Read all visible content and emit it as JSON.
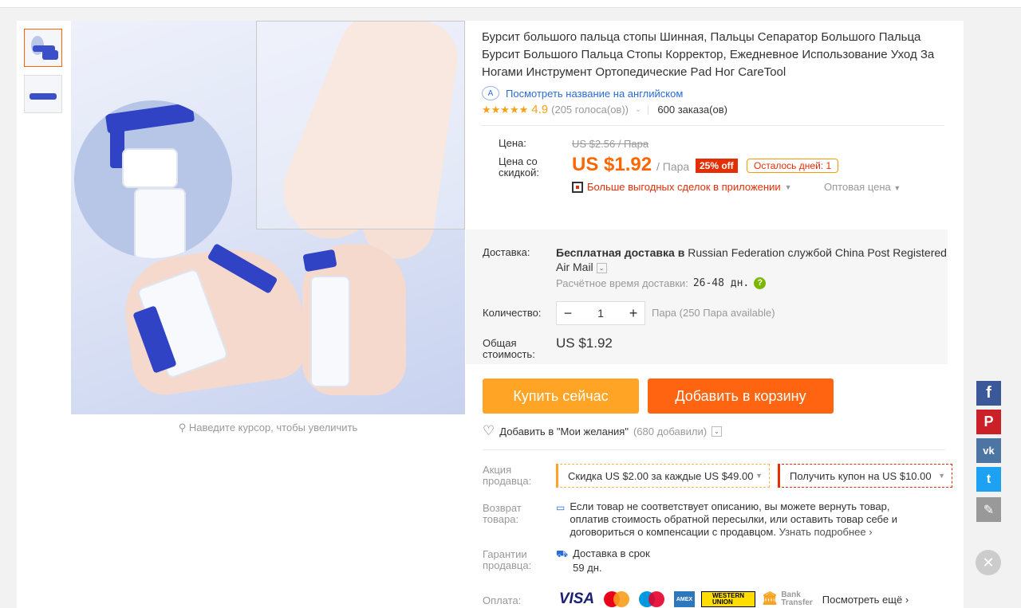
{
  "product": {
    "title": "Бурсит большого пальца стопы Шинная, Пальцы Сепаратор Большого Пальца Бурсит Большого Пальца Стопы Корректор, Ежедневное Использование Уход За Ногами Инструмент Ортопедические Pad Ног CareTool",
    "translate_link": "Посмотреть название на английском",
    "translate_icon": "A",
    "stars": "★★★★★",
    "rating": "4.9",
    "votes": "(205 голоса(ов))",
    "orders": "600 заказа(ов)"
  },
  "gallery": {
    "zoom_hint": "Наведите курсор, чтобы увеличить"
  },
  "price": {
    "label_price": "Цена:",
    "label_discount_1": "Цена со",
    "label_discount_2": "скидкой:",
    "old": "US $2.56 / Пара",
    "current": "US $1.92",
    "unit": "/ Пара",
    "discount_badge": "25% off",
    "days_left": "Осталось дней: 1",
    "app_deals": "Больше выгодных сделок в приложении",
    "wholesale": "Оптовая цена"
  },
  "shipping": {
    "label": "Доставка:",
    "free_bold": "Бесплатная доставка в",
    "destination": "Russian Federation службой China Post Registered Air Mail",
    "est_label": "Расчётное время доставки:",
    "est_days": "26-48 дн.",
    "qty_label": "Количество:",
    "qty_value": "1",
    "qty_minus": "−",
    "qty_plus": "+",
    "available": "Пара (250 Пара available)",
    "total_label_1": "Общая",
    "total_label_2": "стоимость:",
    "total_value": "US $1.92"
  },
  "actions": {
    "buy_now": "Купить сейчас",
    "add_to_cart": "Добавить в корзину",
    "wishlist": "Добавить в \"Мои желания\"",
    "wishlist_count": "(680 добавили)"
  },
  "promo": {
    "label_1": "Акция",
    "label_2": "продавца:",
    "discount": "Скидка US $2.00 за каждые US $49.00",
    "coupon": "Получить купон на US $10.00"
  },
  "returns": {
    "label_1": "Возврат",
    "label_2": "товара:",
    "text": "Если товар не соответствует описанию, вы можете вернуть товар, оплатив стоимость обратной пересылки, или оставить товар себе и договориться о компенсации с продавцом.",
    "more": "Узнать подробнее"
  },
  "guarantee": {
    "label_1": "Гарантии",
    "label_2": "продавца:",
    "line1": "Доставка в срок",
    "line2": "59 дн."
  },
  "payment": {
    "label": "Оплата:",
    "visa": "VISA",
    "amex": "AMEX",
    "western_union_1": "WESTERN",
    "western_union_2": "UNION",
    "bank_1": "Bank",
    "bank_2": "Transfer",
    "see_more": "Посмотреть ещё"
  },
  "share": {
    "fb": "f",
    "pin": "P",
    "vk": "vk",
    "tw": "t",
    "edit": "✎",
    "close": "✕"
  }
}
